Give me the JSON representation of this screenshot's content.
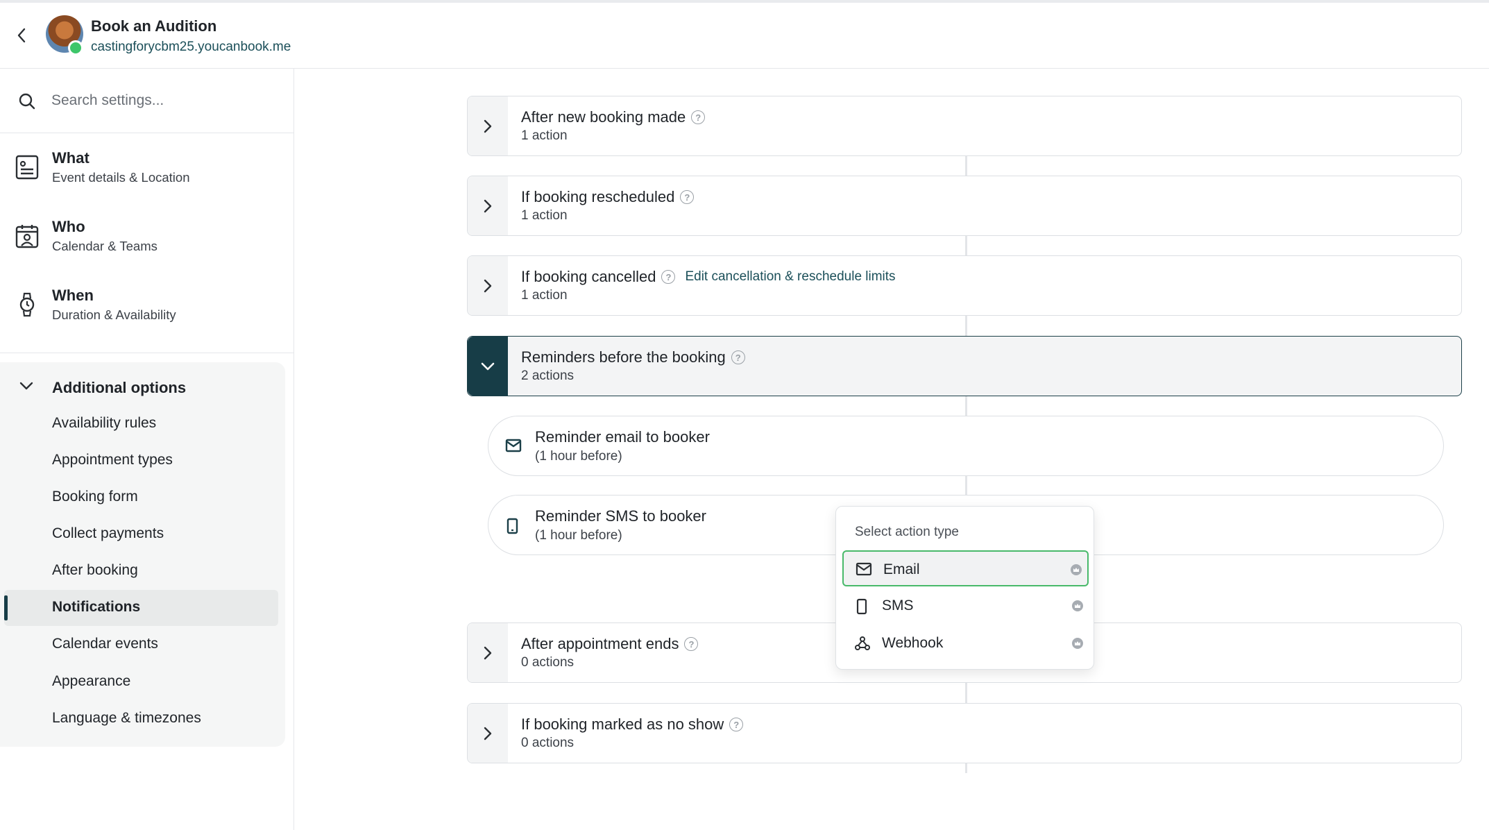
{
  "header": {
    "title": "Book an Audition",
    "url": "castingforycbm25.youcanbook.me"
  },
  "search": {
    "placeholder": "Search settings..."
  },
  "sidebar": {
    "main_items": [
      {
        "title": "What",
        "subtitle": "Event details & Location",
        "icon": "form-icon"
      },
      {
        "title": "Who",
        "subtitle": "Calendar & Teams",
        "icon": "calendar-person-icon"
      },
      {
        "title": "When",
        "subtitle": "Duration & Availability",
        "icon": "watch-icon"
      }
    ],
    "additional": {
      "label": "Additional options",
      "items": [
        "Availability rules",
        "Appointment types",
        "Booking form",
        "Collect payments",
        "After booking",
        "Notifications",
        "Calendar events",
        "Appearance",
        "Language & timezones"
      ],
      "active": "Notifications"
    }
  },
  "workflow": {
    "cards": [
      {
        "title": "After new booking made",
        "subtitle": "1 action"
      },
      {
        "title": "If booking rescheduled",
        "subtitle": "1 action"
      },
      {
        "title": "If booking cancelled",
        "subtitle": "1 action",
        "link": "Edit cancellation & reschedule limits"
      },
      {
        "title": "Reminders before the booking",
        "subtitle": "2 actions"
      },
      {
        "title": "After appointment ends",
        "subtitle": "0 actions"
      },
      {
        "title": "If booking marked as no show",
        "subtitle": "0 actions"
      }
    ],
    "reminders": [
      {
        "title": "Reminder email to booker",
        "subtitle": "(1 hour before)",
        "icon": "mail-icon"
      },
      {
        "title": "Reminder SMS to booker",
        "subtitle": "(1 hour before)",
        "icon": "phone-icon"
      }
    ]
  },
  "dropdown": {
    "heading": "Select action type",
    "options": [
      {
        "label": "Email",
        "icon": "mail-icon"
      },
      {
        "label": "SMS",
        "icon": "phone-icon"
      },
      {
        "label": "Webhook",
        "icon": "webhook-icon"
      }
    ],
    "selected": "Email"
  },
  "colors": {
    "accent_dark": "#173d47",
    "link": "#1b4f59",
    "selected_border": "#48b96a",
    "status_online": "#3ec66a"
  }
}
